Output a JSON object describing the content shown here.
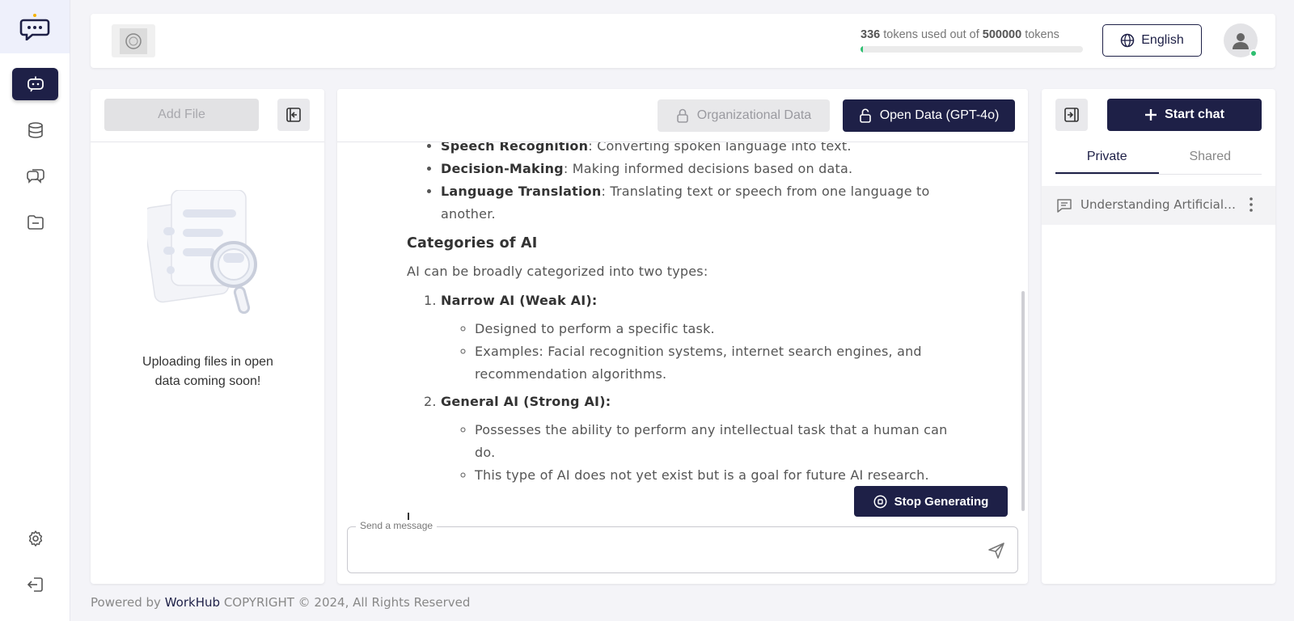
{
  "header": {
    "tokens_used": "336",
    "tokens_mid": "tokens used out of",
    "tokens_total": "500000",
    "tokens_suffix": "tokens",
    "token_progress": 0.0007,
    "language": "English"
  },
  "files": {
    "add_file_label": "Add File",
    "empty_line1": "Uploading files in open",
    "empty_line2": "data coming soon!"
  },
  "chat": {
    "org_data_label": "Organizational Data",
    "open_data_label": "Open Data (GPT-4o)",
    "stop_label": "Stop Generating",
    "input_label": "Send a message",
    "input_value": "",
    "message": {
      "top_list": [
        {
          "bold": "Speech Recognition",
          "text": ": Converting spoken language into text."
        },
        {
          "bold": "Decision-Making",
          "text": ": Making informed decisions based on data."
        },
        {
          "bold": "Language Translation",
          "text": ": Translating text or speech from one language to another."
        }
      ],
      "heading": "Categories of AI",
      "intro": "AI can be broadly categorized into two types:",
      "types": [
        {
          "title": "Narrow AI (Weak AI):",
          "points": [
            "Designed to perform a specific task.",
            "Examples: Facial recognition systems, internet search engines, and recommendation algorithms."
          ]
        },
        {
          "title": "General AI (Strong AI):",
          "points": [
            "Possesses the ability to perform any intellectual task that a human can do.",
            "This type of AI does not yet exist but is a goal for future AI research."
          ]
        }
      ]
    }
  },
  "history": {
    "start_chat_label": "Start chat",
    "tabs": [
      "Private",
      "Shared"
    ],
    "items": [
      "Understanding Artificial Intelligence"
    ]
  },
  "footer": {
    "prefix": "Powered by",
    "brand": "WorkHub",
    "suffix": "COPYRIGHT © 2024, All Rights Reserved"
  },
  "colors": {
    "primary": "#1e2047",
    "online": "#2fbf71"
  }
}
